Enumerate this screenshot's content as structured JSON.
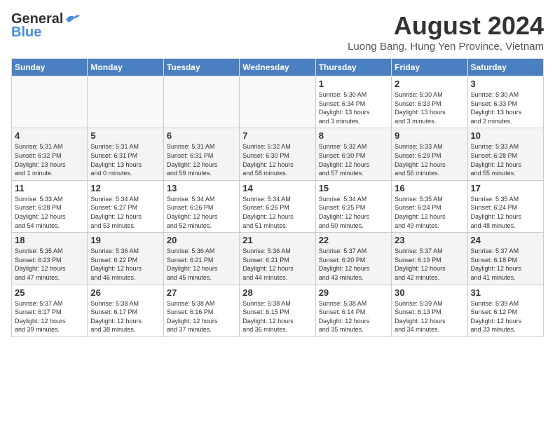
{
  "header": {
    "logo_general": "General",
    "logo_blue": "Blue",
    "month_year": "August 2024",
    "location": "Luong Bang, Hung Yen Province, Vietnam"
  },
  "weekdays": [
    "Sunday",
    "Monday",
    "Tuesday",
    "Wednesday",
    "Thursday",
    "Friday",
    "Saturday"
  ],
  "weeks": [
    [
      {
        "day": "",
        "info": ""
      },
      {
        "day": "",
        "info": ""
      },
      {
        "day": "",
        "info": ""
      },
      {
        "day": "",
        "info": ""
      },
      {
        "day": "1",
        "info": "Sunrise: 5:30 AM\nSunset: 6:34 PM\nDaylight: 13 hours\nand 3 minutes."
      },
      {
        "day": "2",
        "info": "Sunrise: 5:30 AM\nSunset: 6:33 PM\nDaylight: 13 hours\nand 3 minutes."
      },
      {
        "day": "3",
        "info": "Sunrise: 5:30 AM\nSunset: 6:33 PM\nDaylight: 13 hours\nand 2 minutes."
      }
    ],
    [
      {
        "day": "4",
        "info": "Sunrise: 5:31 AM\nSunset: 6:32 PM\nDaylight: 13 hours\nand 1 minute."
      },
      {
        "day": "5",
        "info": "Sunrise: 5:31 AM\nSunset: 6:31 PM\nDaylight: 13 hours\nand 0 minutes."
      },
      {
        "day": "6",
        "info": "Sunrise: 5:31 AM\nSunset: 6:31 PM\nDaylight: 12 hours\nand 59 minutes."
      },
      {
        "day": "7",
        "info": "Sunrise: 5:32 AM\nSunset: 6:30 PM\nDaylight: 12 hours\nand 58 minutes."
      },
      {
        "day": "8",
        "info": "Sunrise: 5:32 AM\nSunset: 6:30 PM\nDaylight: 12 hours\nand 57 minutes."
      },
      {
        "day": "9",
        "info": "Sunrise: 5:33 AM\nSunset: 6:29 PM\nDaylight: 12 hours\nand 56 minutes."
      },
      {
        "day": "10",
        "info": "Sunrise: 5:33 AM\nSunset: 6:28 PM\nDaylight: 12 hours\nand 55 minutes."
      }
    ],
    [
      {
        "day": "11",
        "info": "Sunrise: 5:33 AM\nSunset: 6:28 PM\nDaylight: 12 hours\nand 54 minutes."
      },
      {
        "day": "12",
        "info": "Sunrise: 5:34 AM\nSunset: 6:27 PM\nDaylight: 12 hours\nand 53 minutes."
      },
      {
        "day": "13",
        "info": "Sunrise: 5:34 AM\nSunset: 6:26 PM\nDaylight: 12 hours\nand 52 minutes."
      },
      {
        "day": "14",
        "info": "Sunrise: 5:34 AM\nSunset: 6:26 PM\nDaylight: 12 hours\nand 51 minutes."
      },
      {
        "day": "15",
        "info": "Sunrise: 5:34 AM\nSunset: 6:25 PM\nDaylight: 12 hours\nand 50 minutes."
      },
      {
        "day": "16",
        "info": "Sunrise: 5:35 AM\nSunset: 6:24 PM\nDaylight: 12 hours\nand 49 minutes."
      },
      {
        "day": "17",
        "info": "Sunrise: 5:35 AM\nSunset: 6:24 PM\nDaylight: 12 hours\nand 48 minutes."
      }
    ],
    [
      {
        "day": "18",
        "info": "Sunrise: 5:35 AM\nSunset: 6:23 PM\nDaylight: 12 hours\nand 47 minutes."
      },
      {
        "day": "19",
        "info": "Sunrise: 5:36 AM\nSunset: 6:22 PM\nDaylight: 12 hours\nand 46 minutes."
      },
      {
        "day": "20",
        "info": "Sunrise: 5:36 AM\nSunset: 6:21 PM\nDaylight: 12 hours\nand 45 minutes."
      },
      {
        "day": "21",
        "info": "Sunrise: 5:36 AM\nSunset: 6:21 PM\nDaylight: 12 hours\nand 44 minutes."
      },
      {
        "day": "22",
        "info": "Sunrise: 5:37 AM\nSunset: 6:20 PM\nDaylight: 12 hours\nand 43 minutes."
      },
      {
        "day": "23",
        "info": "Sunrise: 5:37 AM\nSunset: 6:19 PM\nDaylight: 12 hours\nand 42 minutes."
      },
      {
        "day": "24",
        "info": "Sunrise: 5:37 AM\nSunset: 6:18 PM\nDaylight: 12 hours\nand 41 minutes."
      }
    ],
    [
      {
        "day": "25",
        "info": "Sunrise: 5:37 AM\nSunset: 6:17 PM\nDaylight: 12 hours\nand 39 minutes."
      },
      {
        "day": "26",
        "info": "Sunrise: 5:38 AM\nSunset: 6:17 PM\nDaylight: 12 hours\nand 38 minutes."
      },
      {
        "day": "27",
        "info": "Sunrise: 5:38 AM\nSunset: 6:16 PM\nDaylight: 12 hours\nand 37 minutes."
      },
      {
        "day": "28",
        "info": "Sunrise: 5:38 AM\nSunset: 6:15 PM\nDaylight: 12 hours\nand 36 minutes."
      },
      {
        "day": "29",
        "info": "Sunrise: 5:38 AM\nSunset: 6:14 PM\nDaylight: 12 hours\nand 35 minutes."
      },
      {
        "day": "30",
        "info": "Sunrise: 5:39 AM\nSunset: 6:13 PM\nDaylight: 12 hours\nand 34 minutes."
      },
      {
        "day": "31",
        "info": "Sunrise: 5:39 AM\nSunset: 6:12 PM\nDaylight: 12 hours\nand 33 minutes."
      }
    ]
  ]
}
